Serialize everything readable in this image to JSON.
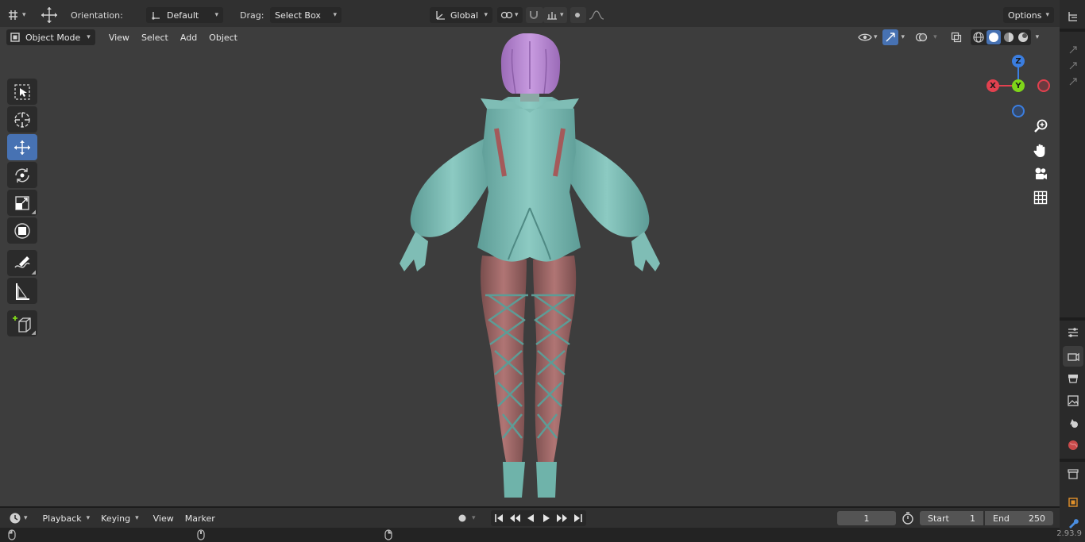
{
  "header": {
    "orientation_label": "Orientation:",
    "orientation_value": "Default",
    "drag_label": "Drag:",
    "drag_value": "Select Box",
    "transform_orientation": "Global",
    "options_label": "Options"
  },
  "viewport_header": {
    "mode": "Object Mode",
    "menus": [
      "View",
      "Select",
      "Add",
      "Object"
    ]
  },
  "gizmo": {
    "z": "Z",
    "y": "Y",
    "x": "X"
  },
  "timeline": {
    "menus": [
      "Playback",
      "Keying",
      "View",
      "Marker"
    ],
    "current_frame": "1",
    "start_label": "Start",
    "start_value": "1",
    "end_label": "End",
    "end_value": "250"
  },
  "version": "2.93.9",
  "colors": {
    "accent": "#4772b3",
    "x_axis": "#e2414f",
    "y_axis": "#7fd51a",
    "z_axis": "#3b7ee0",
    "viewport_bg": "#3d3d3d"
  }
}
